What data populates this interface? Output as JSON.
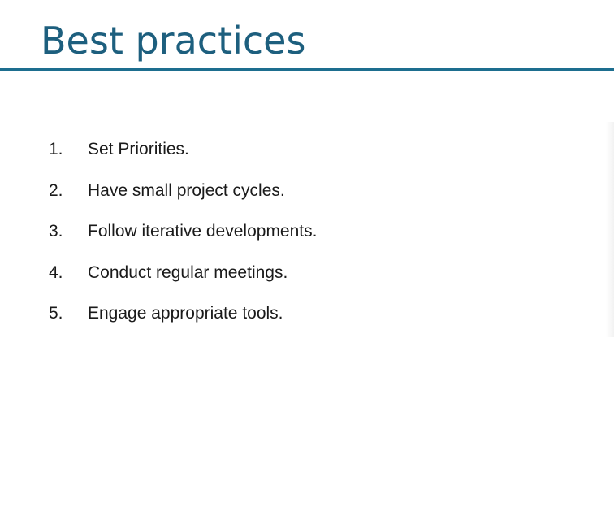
{
  "slide": {
    "title": "Best practices",
    "accent_color": "#1d5f7e",
    "items": [
      {
        "number": "1.",
        "text": "Set Priorities."
      },
      {
        "number": "2.",
        "text": "Have small project cycles."
      },
      {
        "number": "3.",
        "text": "Follow iterative developments."
      },
      {
        "number": "4.",
        "text": "Conduct regular meetings."
      },
      {
        "number": "5.",
        "text": "Engage appropriate tools."
      }
    ]
  }
}
